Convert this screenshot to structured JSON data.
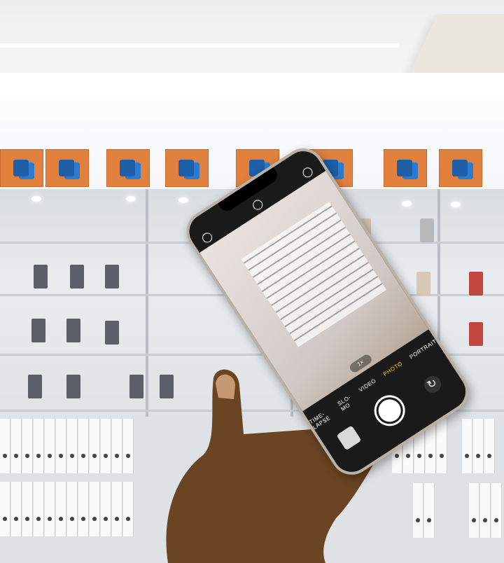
{
  "scene": {
    "description_tags": [
      "phone-store",
      "iphone-camera-app",
      "hand-holding-phone"
    ]
  },
  "camera_app": {
    "modes": [
      "TIME-LAPSE",
      "SLO-MO",
      "VIDEO",
      "PHOTO",
      "PORTRAIT"
    ],
    "active_mode": "PHOTO",
    "zoom": "1×"
  },
  "colors": {
    "box_orange": "#e2813e",
    "box_blue": "#1e5fa8",
    "active_mode": "#ffcc00"
  }
}
